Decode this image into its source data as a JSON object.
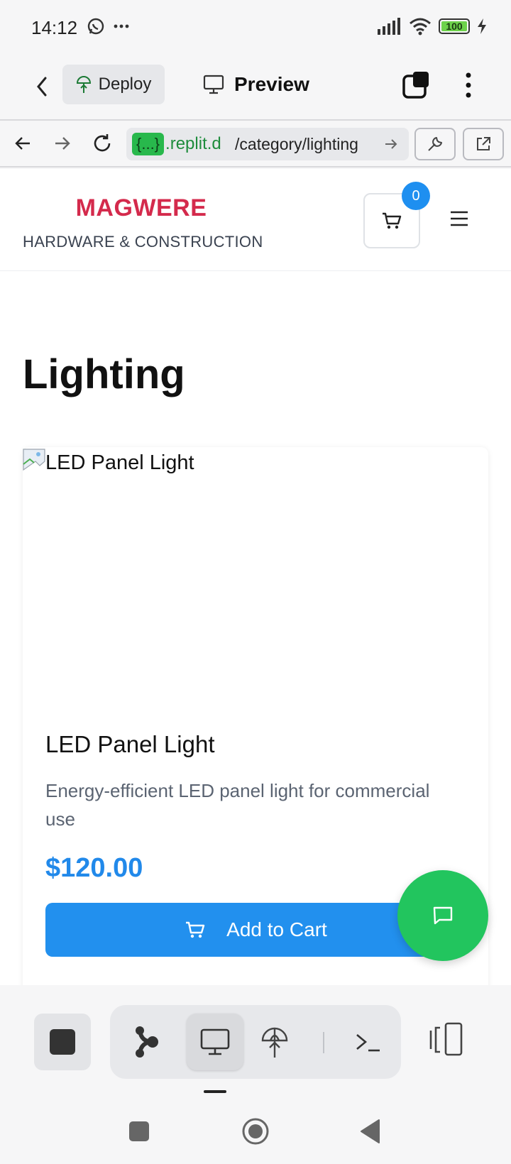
{
  "status_bar": {
    "time": "14:12",
    "icons": [
      "whatsapp-icon",
      "more-dots-icon",
      "signal-icon",
      "wifi-icon",
      "battery-icon",
      "charging-icon"
    ],
    "battery_level": "100"
  },
  "replit_bar": {
    "deploy_label": "Deploy",
    "preview_label": "Preview"
  },
  "browser": {
    "url_badge": "{...}",
    "url_domain": ".replit.d",
    "url_path": "/category/lighting"
  },
  "site": {
    "brand_name": "MAGWERE",
    "brand_tagline": "HARDWARE & CONSTRUCTION",
    "cart_count": "0"
  },
  "page": {
    "title": "Lighting"
  },
  "product": {
    "image_alt": "LED Panel Light",
    "name": "LED Panel Light",
    "description": "Energy-efficient LED panel light for commercial use",
    "price": "$120.00",
    "add_to_cart_label": "Add to Cart"
  },
  "colors": {
    "brand": "#d42a4c",
    "accent_blue": "#2290ee",
    "chat_green": "#22c55e",
    "url_green": "#28b84c"
  }
}
